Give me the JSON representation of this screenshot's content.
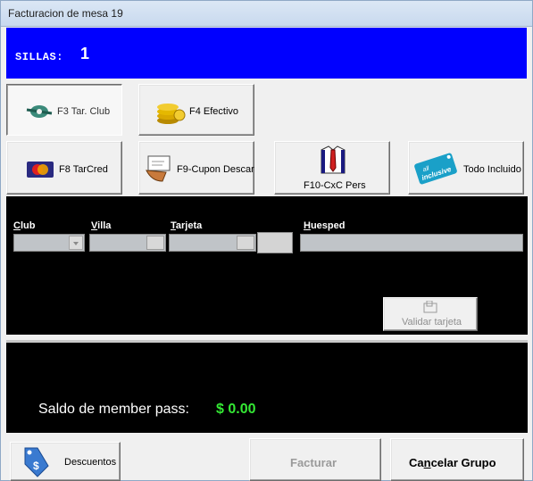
{
  "window": {
    "title": "Facturacion de mesa 19"
  },
  "header": {
    "sillas_label": "SILLAS:",
    "sillas_value": "1"
  },
  "payment_buttons": {
    "f3": "F3 Tar. Club",
    "f4": "F4  Efectivo",
    "f8": "F8 TarCred",
    "f9": "F9-Cupon Descar",
    "f10": "F10-CxC Pers",
    "todo": "Todo Incluido",
    "all_inclusive_tag": "all inclusive"
  },
  "card_panel": {
    "club_label_u": "C",
    "club_label_rest": "lub",
    "villa_label_u": "V",
    "villa_label_rest": "illa",
    "tarjeta_label_u": "T",
    "tarjeta_label_rest": "arjeta",
    "huesped_label_u": "H",
    "huesped_label_rest": "uesped",
    "validar_label": "Validar tarjeta"
  },
  "balance": {
    "label": "Saldo de member pass:",
    "value": "$ 0.00"
  },
  "footer": {
    "descuentos": "Descuentos",
    "facturar": "Facturar",
    "cancelar_pre": "Ca",
    "cancelar_u": "n",
    "cancelar_post": "celar Grupo"
  },
  "colors": {
    "header_bg": "#0000ff",
    "panel_bg": "#000000",
    "balance_value": "#34e834"
  }
}
